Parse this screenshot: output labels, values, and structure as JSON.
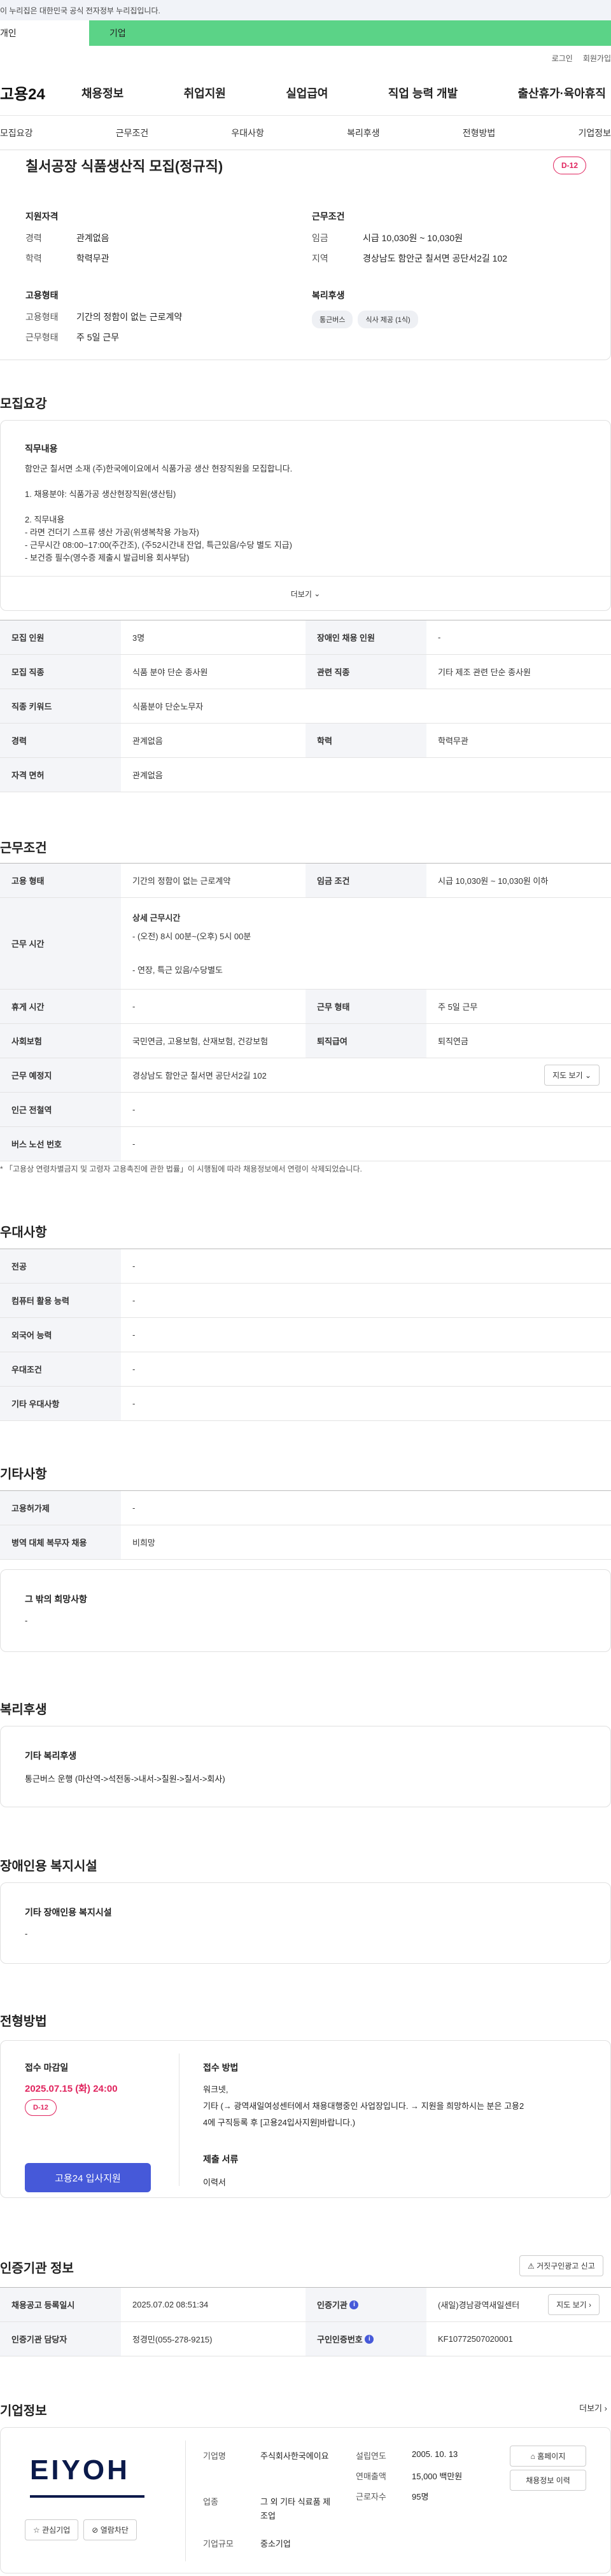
{
  "gov_banner": "이 누리집은 대한민국 공식 전자정부 누리집입니다.",
  "user_tabs": {
    "personal": "개인",
    "company": "기업"
  },
  "util": {
    "login": "로그인",
    "signup": "회원가입"
  },
  "logo": "고용24",
  "gnb": [
    "채용정보",
    "취업지원",
    "실업급여",
    "직업 능력 개발",
    "출산휴가·육아휴직"
  ],
  "subtabs": [
    "모집요강",
    "근무조건",
    "우대사항",
    "복리후생",
    "전형방법",
    "기업정보"
  ],
  "job": {
    "title": "칠서공장 식품생산직 모집(정규직)",
    "dday": "D-12",
    "qual_heading": "지원자격",
    "career_label": "경력",
    "career_value": "관계없음",
    "edu_label": "학력",
    "edu_value": "학력무관",
    "cond_heading": "근무조건",
    "wage_label": "임금",
    "wage_value": "시급 10,030원 ~ 10,030원",
    "region_label": "지역",
    "region_value": "경상남도 함안군 칠서면 공단서2길 102",
    "emp_heading": "고용형태",
    "emp_type_label": "고용형태",
    "emp_type_value": "기간의 정함이 없는 근로계약",
    "work_type_label": "근무형태",
    "work_type_value": "주 5일 근무",
    "welfare_heading": "복리후생",
    "welfare_chips": [
      "통근버스",
      "식사 제공 (1식)"
    ]
  },
  "recruit": {
    "heading": "모집요강",
    "duty_title": "직무내용",
    "lines": [
      "함안군 칠서면 소재 (주)한국에이요에서 식품가공 생산 현장직원을 모집합니다.",
      "",
      "1. 채용분야: 식품가공 생산현장직원(생산팀)",
      "",
      "2. 직무내용",
      "- 라면 건더기 스프류 생산 가공(위생복착용 가능자)",
      "- 근무시간 08:00~17:00(주간조), (주52시간내 잔업, 특근있음/수당 별도 지급)",
      "- 보건증 필수(영수증 제출시 발급비용 회사부담)"
    ],
    "more": "더보기",
    "rows": [
      [
        "모집 인원",
        "3명",
        "장애인 채용 인원",
        "-"
      ],
      [
        "모집 직종",
        "식품 분야 단순 종사원",
        "관련 직종",
        "기타 제조 관련 단순 종사원"
      ],
      [
        "직종 키워드",
        "식품분야 단순노무자"
      ],
      [
        "경력",
        "관계없음",
        "학력",
        "학력무관"
      ],
      [
        "자격 면허",
        "관계없음"
      ]
    ]
  },
  "work": {
    "heading": "근무조건",
    "emp_type": [
      "고용 형태",
      "기간의 정함이 없는 근로계약",
      "임금 조건",
      "시급 10,030원 ~ 10,030원 이하"
    ],
    "time_label": "근무 시간",
    "time_title": "상세 근무시간",
    "time_line1": "- (오전) 8시 00분~(오후) 5시 00분",
    "time_line2": "- 연장, 특근 있음/수당별도",
    "rest": [
      "휴게 시간",
      "-",
      "근무 형태",
      "주 5일 근무"
    ],
    "insurance": [
      "사회보험",
      "국민연금, 고용보험, 산재보험, 건강보험",
      "퇴직급여",
      "퇴직연금"
    ],
    "location_label": "근무 예정지",
    "location_value": "경상남도 함안군 칠서면 공단서2길 102",
    "map_button": "지도 보기",
    "subway": [
      "인근 전철역",
      "-"
    ],
    "bus": [
      "버스 노선 번호",
      "-"
    ],
    "note": "「고용상 연령차별금지 및 고령자 고용촉진에 관한 법률」이 시행됨에 따라 채용정보에서 연령이 삭제되었습니다."
  },
  "preference": {
    "heading": "우대사항",
    "rows": [
      [
        "전공",
        "-"
      ],
      [
        "컴퓨터 활용 능력",
        "-"
      ],
      [
        "외국어 능력",
        "-"
      ],
      [
        "우대조건",
        "-"
      ],
      [
        "기타 우대사항",
        "-"
      ]
    ]
  },
  "etc": {
    "heading": "기타사항",
    "rows": [
      [
        "고용허가제",
        "-"
      ],
      [
        "병역 대체 복무자 채용",
        "비희망"
      ]
    ],
    "wish_title": "그 밖의 희망사항",
    "wish_value": "-"
  },
  "welfare": {
    "heading": "복리후생",
    "box_title": "기타 복리후생",
    "box_value": "통근버스 운행 (마산역->석전동->내서->칠원->칠서->회사)"
  },
  "disabled": {
    "heading": "장애인용 복지시설",
    "box_title": "기타 장애인용 복지시설",
    "box_value": "-"
  },
  "selection": {
    "heading": "전형방법",
    "deadline_label": "접수 마감일",
    "deadline_value": "2025.07.15 (화) 24:00",
    "dday": "D-12",
    "apply_button": "고용24 입사지원",
    "method_label": "접수 방법",
    "method_line1": "워크넷,",
    "method_line2": "기타 (→ 광역새일여성센터에서 채용대행중인 사업장입니다. → 지원을 희망하시는 분은 고용2",
    "method_line3": "4에 구직등록 후 [고용24입사지원]바랍니다.)",
    "docs_label": "제출 서류",
    "docs_value": "이력서"
  },
  "cert": {
    "heading": "인증기관 정보",
    "report_button": "거짓구인광고 신고",
    "rows": [
      [
        "채용공고 등록일시",
        "2025.07.02 08:51:34",
        "인증기관",
        "(새일)경남광역새일센터"
      ],
      [
        "인증기관 담당자",
        "정경민(055-278-9215)",
        "구인인증번호",
        "KF10772507020001"
      ]
    ],
    "map_button": "지도 보기"
  },
  "company": {
    "heading": "기업정보",
    "more": "더보기",
    "logo_text": "EIYOH",
    "fav_button": "관심기업",
    "block_button": "열람차단",
    "name_label": "기업명",
    "name_value": "주식회사한국에이요",
    "industry_label": "업종",
    "industry_value": "그 외 기타 식료품 제조업",
    "size_label": "기업규모",
    "size_value": "중소기업",
    "founded_label": "설립연도",
    "founded_value": "2005. 10. 13",
    "revenue_label": "연매출액",
    "revenue_value": "15,000 백만원",
    "employees_label": "근로자수",
    "employees_value": "95명",
    "homepage_button": "홈페이지",
    "jobs_button": "채용정보 이력"
  }
}
